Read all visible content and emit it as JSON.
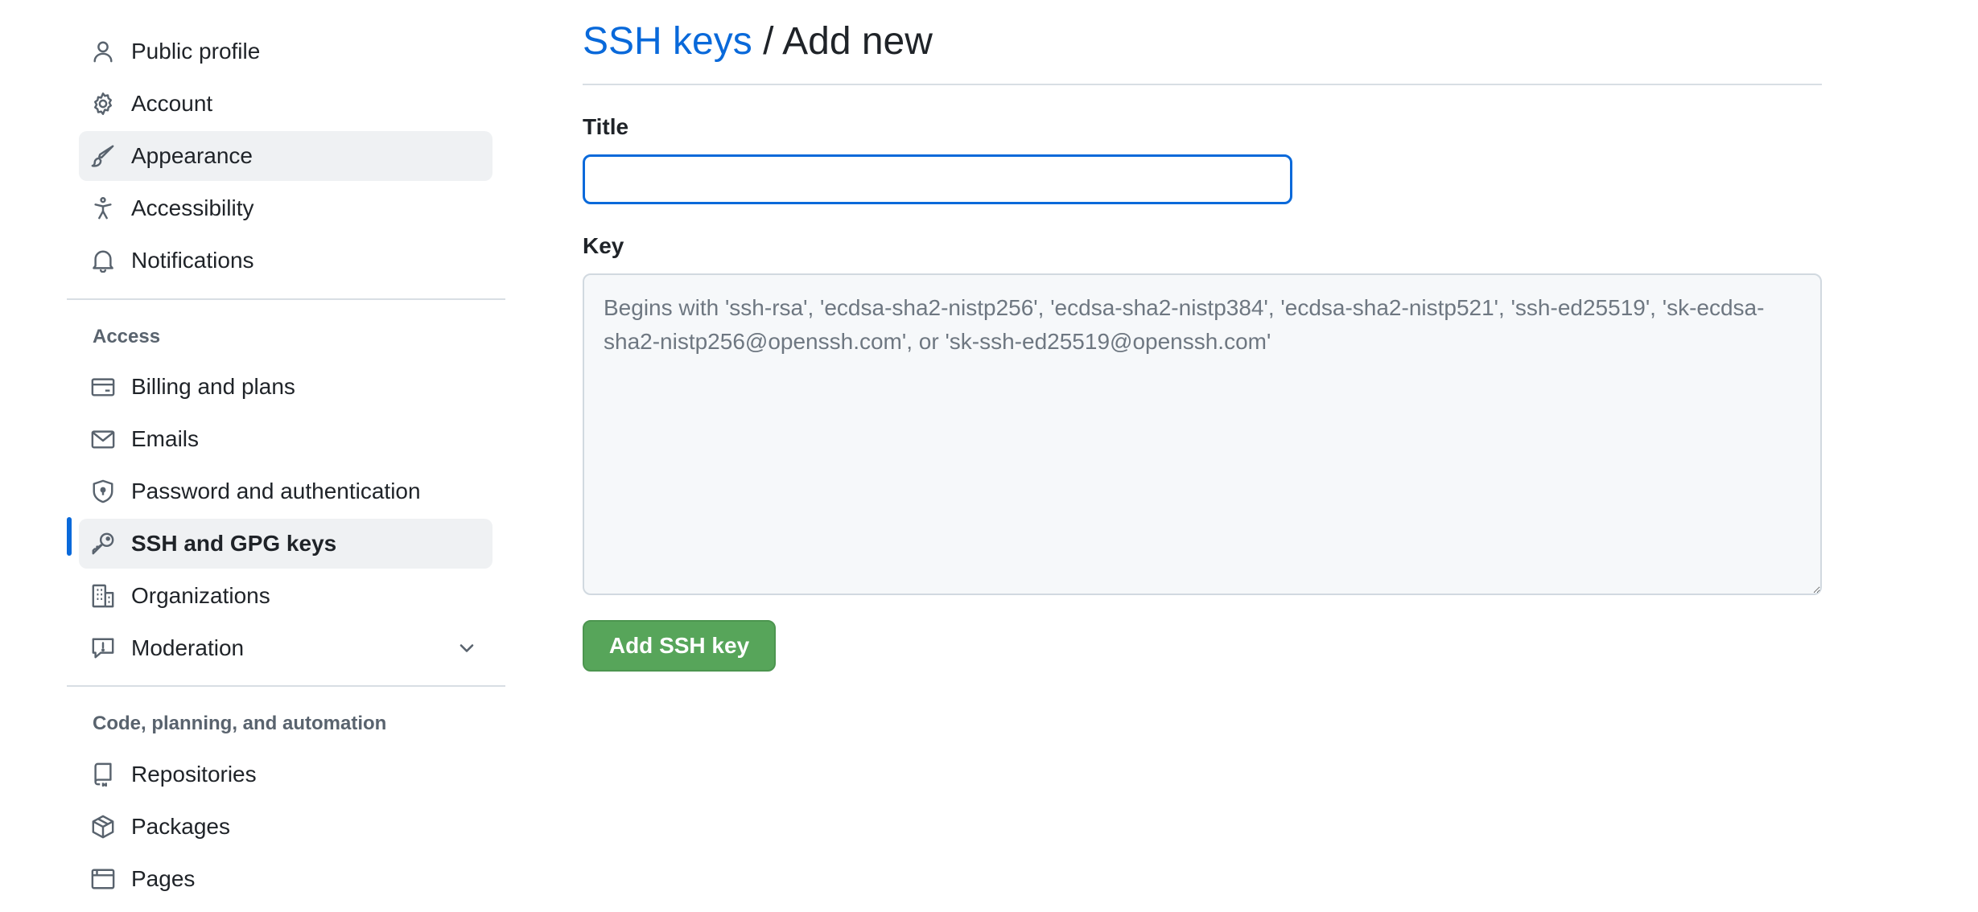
{
  "sidebar": {
    "items": [
      {
        "label": "Public profile",
        "icon": "person-icon"
      },
      {
        "label": "Account",
        "icon": "gear-icon"
      },
      {
        "label": "Appearance",
        "icon": "paintbrush-icon"
      },
      {
        "label": "Accessibility",
        "icon": "accessibility-icon"
      },
      {
        "label": "Notifications",
        "icon": "bell-icon"
      }
    ],
    "access_heading": "Access",
    "access_items": [
      {
        "label": "Billing and plans",
        "icon": "credit-card-icon"
      },
      {
        "label": "Emails",
        "icon": "mail-icon"
      },
      {
        "label": "Password and authentication",
        "icon": "shield-lock-icon"
      },
      {
        "label": "SSH and GPG keys",
        "icon": "key-icon"
      },
      {
        "label": "Organizations",
        "icon": "organization-icon"
      },
      {
        "label": "Moderation",
        "icon": "report-icon"
      }
    ],
    "code_heading": "Code, planning, and automation",
    "code_items": [
      {
        "label": "Repositories",
        "icon": "repo-icon"
      },
      {
        "label": "Packages",
        "icon": "package-icon"
      },
      {
        "label": "Pages",
        "icon": "browser-icon"
      }
    ],
    "active_item": "SSH and GPG keys",
    "hover_item": "Appearance"
  },
  "header": {
    "breadcrumb_link": "SSH keys",
    "separator": "/",
    "current": "Add new"
  },
  "form": {
    "title_label": "Title",
    "title_value": "",
    "key_label": "Key",
    "key_placeholder": "Begins with 'ssh-rsa', 'ecdsa-sha2-nistp256', 'ecdsa-sha2-nistp384', 'ecdsa-sha2-nistp521', 'ssh-ed25519', 'sk-ecdsa-sha2-nistp256@openssh.com', or 'sk-ssh-ed25519@openssh.com'",
    "submit_label": "Add SSH key"
  },
  "colors": {
    "accent": "#0969da",
    "button_green": "#57a55a",
    "active_bg": "#eff1f3",
    "muted_text": "#59636e"
  }
}
